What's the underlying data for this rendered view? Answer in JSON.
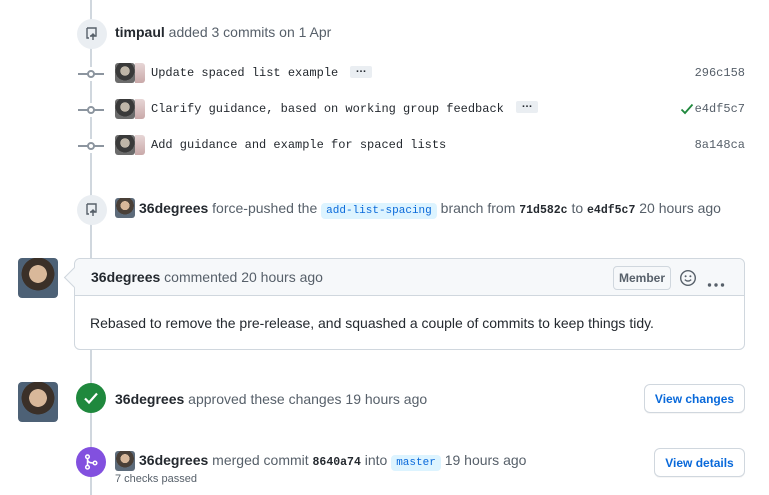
{
  "push_event": {
    "actor": "timpaul",
    "action": "added 3 commits on 1 Apr",
    "icon": "repo-push-icon"
  },
  "commits": [
    {
      "message": "Update spaced list example",
      "sha": "296c158",
      "verified": false
    },
    {
      "message": "Clarify guidance, based on working group feedback",
      "sha": "e4df5c7",
      "verified": true
    },
    {
      "message": "Add guidance and example for spaced lists",
      "sha": "8a148ca",
      "verified": false
    }
  ],
  "force_push": {
    "actor": "36degrees",
    "action": "force-pushed the",
    "branch": "add-list-spacing",
    "branch_from": "branch from",
    "from_sha": "71d582c",
    "to_word": "to",
    "to_sha": "e4df5c7",
    "time": "20 hours ago"
  },
  "comment": {
    "author": "36degrees",
    "action": "commented",
    "time": "20 hours ago",
    "role": "Member",
    "body": "Rebased to remove the pre-release, and squashed a couple of commits to keep things tidy."
  },
  "review": {
    "author": "36degrees",
    "action": "approved these changes",
    "time": "19 hours ago",
    "button": "View changes"
  },
  "merge": {
    "author": "36degrees",
    "action": "merged commit",
    "sha": "8640a74",
    "into": "into",
    "branch": "master",
    "time": "19 hours ago",
    "checks": "7 checks passed",
    "button": "View details"
  },
  "ellipsis": "…",
  "colors": {
    "link": "#0969da",
    "green": "#1f883d",
    "purple": "#8250df"
  }
}
